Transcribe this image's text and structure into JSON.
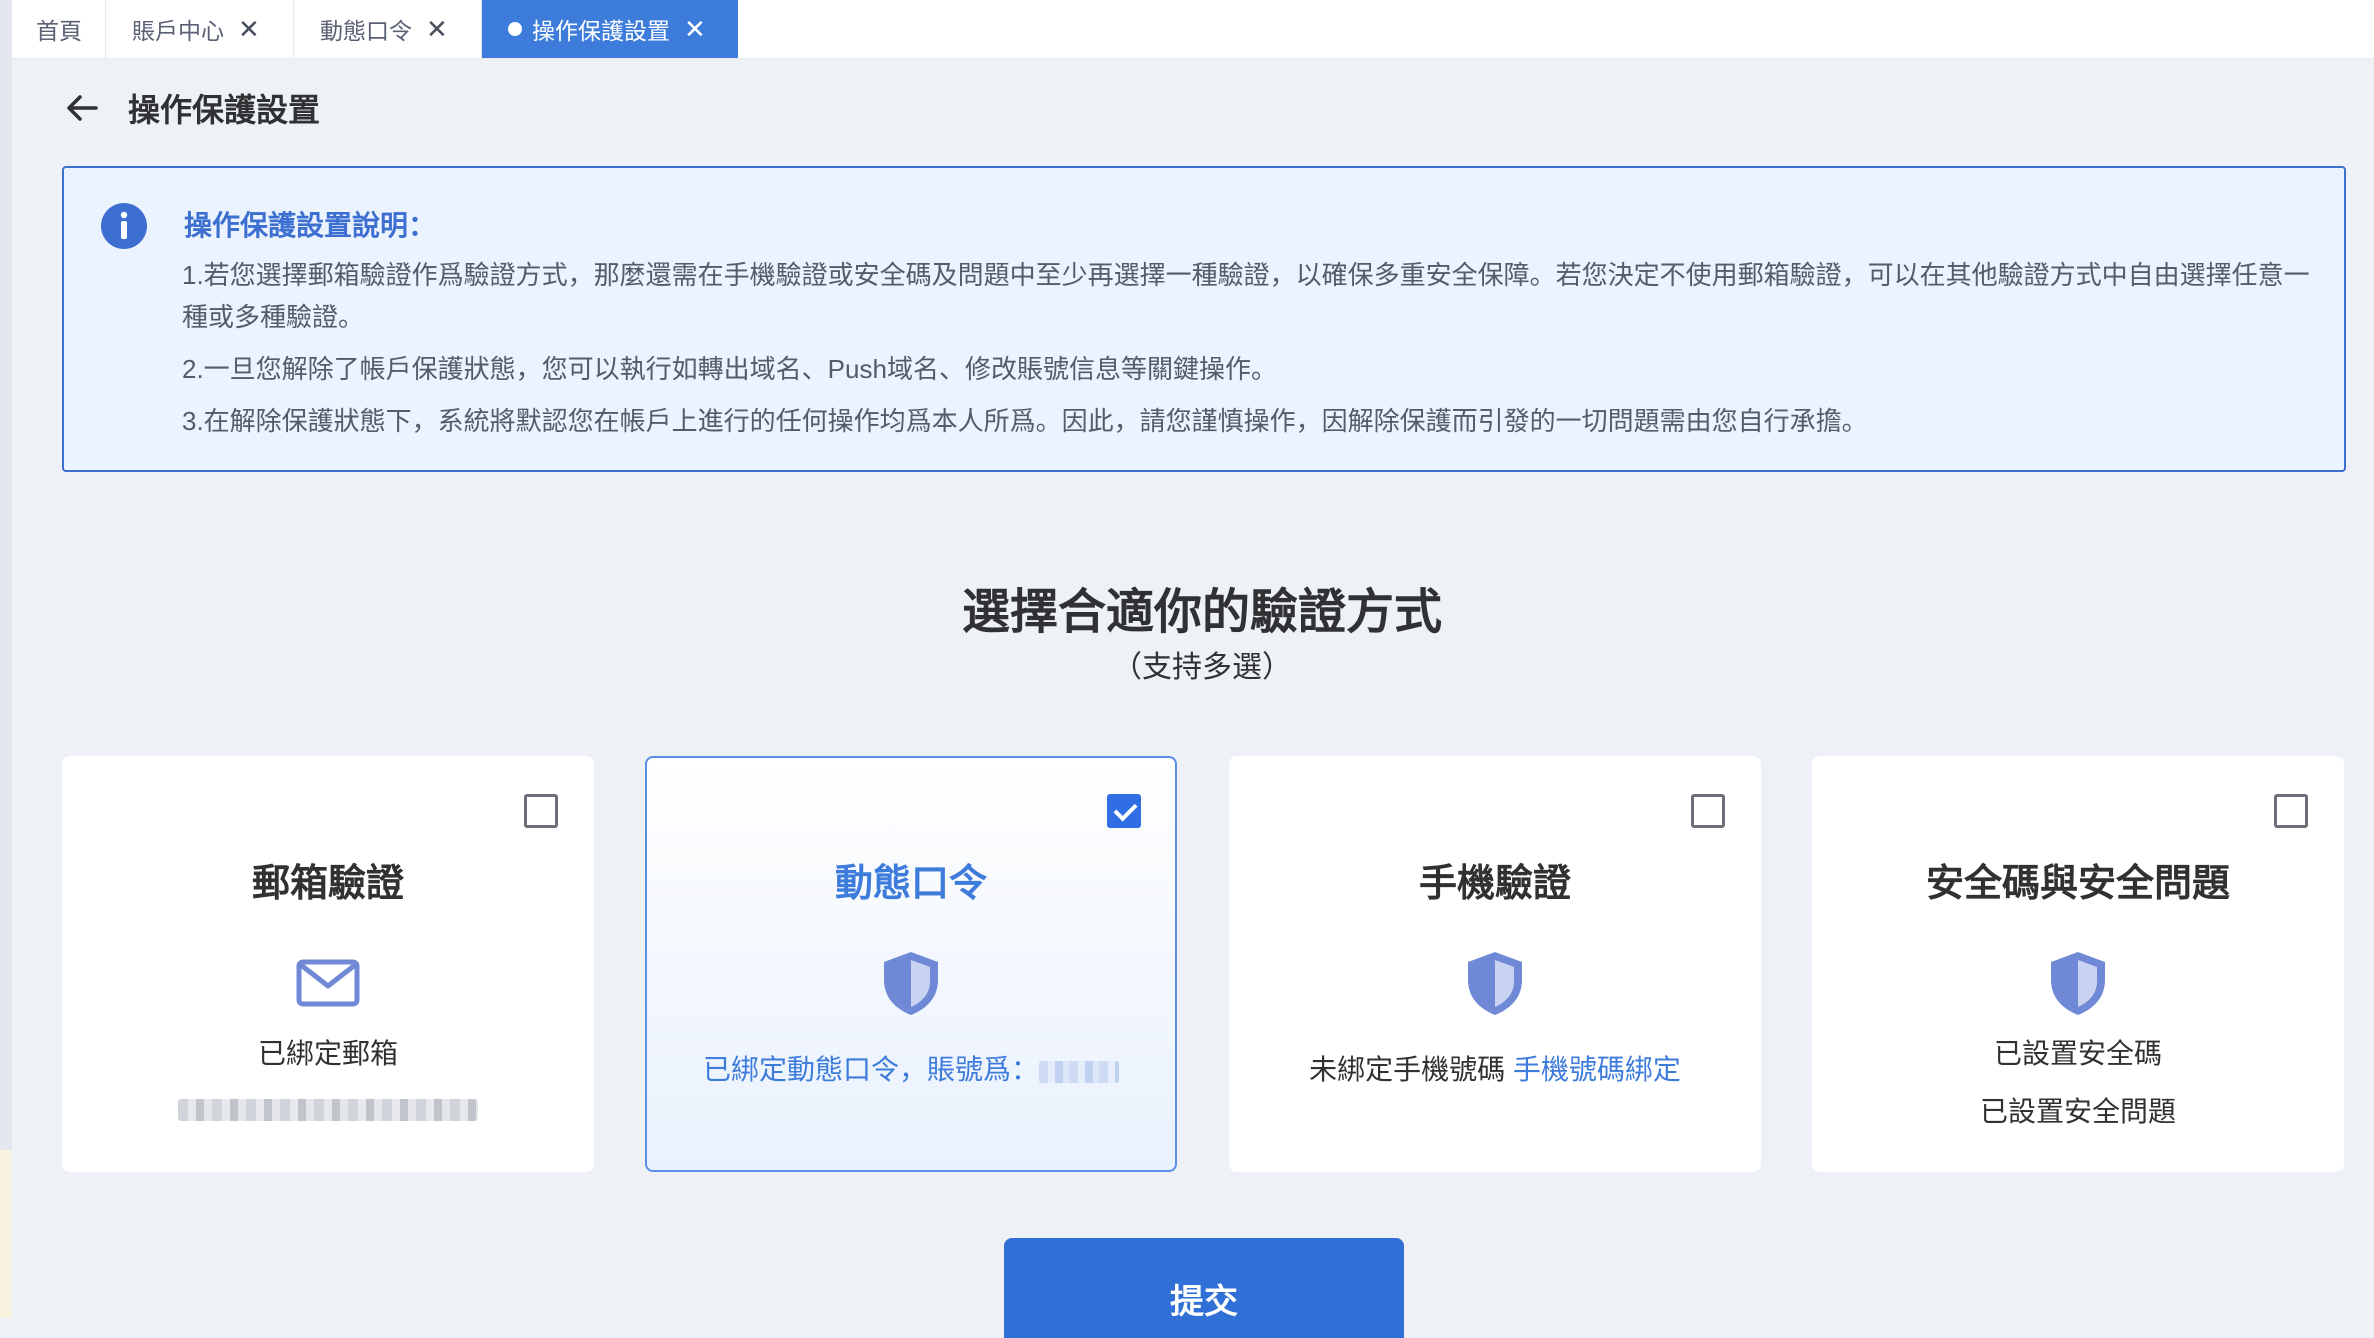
{
  "tabs": [
    {
      "label": "首頁",
      "closable": false,
      "active": false
    },
    {
      "label": "賬戶中心",
      "closable": true,
      "active": false
    },
    {
      "label": "動態口令",
      "closable": true,
      "active": false
    },
    {
      "label": "操作保護設置",
      "closable": true,
      "active": true
    }
  ],
  "header": {
    "title": "操作保護設置"
  },
  "notice": {
    "title": "操作保護設置說明：",
    "lines": [
      "1.若您選擇郵箱驗證作爲驗證方式，那麼還需在手機驗證或安全碼及問題中至少再選擇一種驗證，以確保多重安全保障。若您決定不使用郵箱驗證，可以在其他驗證方式中自由選擇任意一種或多種驗證。",
      "2.一旦您解除了帳戶保護狀態，您可以執行如轉出域名、Push域名、修改賬號信息等關鍵操作。",
      "3.在解除保護狀態下，系統將默認您在帳戶上進行的任何操作均爲本人所爲。因此，請您謹慎操作，因解除保護而引發的一切問題需由您自行承擔。"
    ]
  },
  "selection": {
    "title": "選擇合適你的驗證方式",
    "subtitle": "（支持多選）"
  },
  "cards": [
    {
      "title": "郵箱驗證",
      "checked": false,
      "icon": "mail-icon",
      "line1": "已綁定郵箱"
    },
    {
      "title": "動態口令",
      "checked": true,
      "icon": "shield-icon",
      "line1": "已綁定動態口令，賬號爲："
    },
    {
      "title": "手機驗證",
      "checked": false,
      "icon": "shield-icon",
      "line1": "未綁定手機號碼",
      "link": "手機號碼綁定"
    },
    {
      "title": "安全碼與安全問題",
      "checked": false,
      "icon": "shield-icon",
      "line1": "已設置安全碼",
      "line2": "已設置安全問題"
    }
  ],
  "submit": {
    "label": "提交"
  },
  "colors": {
    "primary": "#3d7cdb",
    "notice_bg": "#eaf3fe",
    "page_bg": "#eef1f6",
    "shield": "#6a86d8"
  }
}
